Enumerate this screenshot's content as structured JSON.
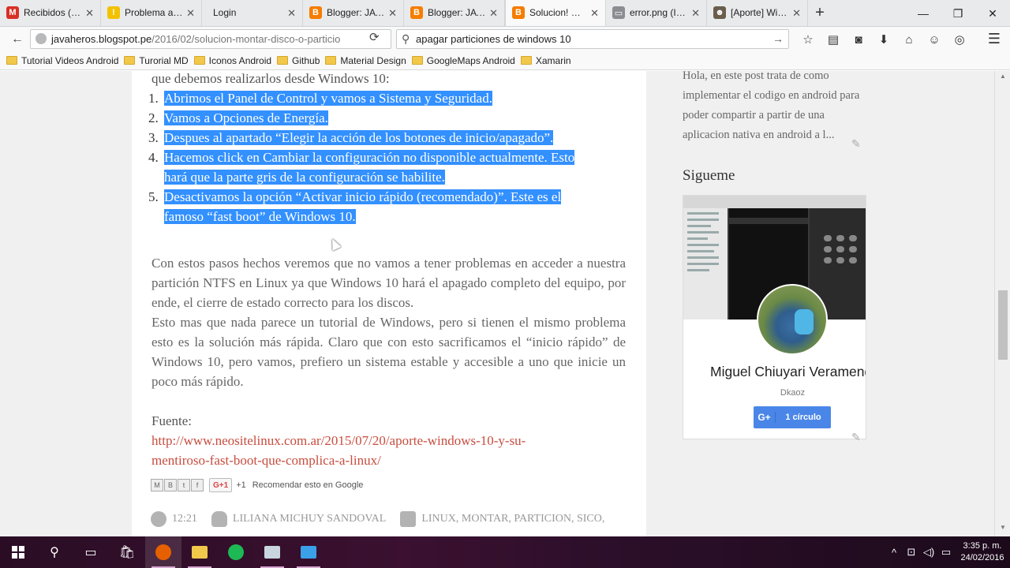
{
  "tabs": [
    {
      "label": "Recibidos (13...",
      "icon": "gmail-icon",
      "color": "#d93025",
      "glyph": "M"
    },
    {
      "label": "Problema al ...",
      "icon": "warning-icon",
      "color": "#f2c200",
      "glyph": "!"
    },
    {
      "label": "Login",
      "icon": "",
      "color": "",
      "glyph": ""
    },
    {
      "label": "Blogger: JAV...",
      "icon": "blogger-icon",
      "color": "#f57d00",
      "glyph": "B"
    },
    {
      "label": "Blogger: JAV...",
      "icon": "blogger-icon",
      "color": "#f57d00",
      "glyph": "B"
    },
    {
      "label": "Solucion! mo...",
      "icon": "blogger-icon",
      "color": "#f57d00",
      "glyph": "B"
    },
    {
      "label": "error.png (Im...",
      "icon": "image-icon",
      "color": "#8a8d91",
      "glyph": "▭"
    },
    {
      "label": "[Aporte] Win...",
      "icon": "penguin-icon",
      "color": "#6a5d4d",
      "glyph": "☻"
    }
  ],
  "active_tab": 5,
  "nav": {
    "url_host": "javaheros.blogspot.pe",
    "url_path": "/2016/02/solucion-montar-disco-o-particio",
    "search_query": "apagar particiones de windows 10"
  },
  "bookmarks": [
    "Tutorial Videos Android",
    "Turorial MD",
    "Iconos Android",
    "Github",
    "Material Design",
    "GoogleMaps Android",
    "Xamarin"
  ],
  "post": {
    "intro": "que debemos realizarlos desde Windows 10:",
    "steps": [
      {
        "num": "1.",
        "lines": [
          "Abrimos el Panel de Control y vamos a Sistema y Seguridad."
        ]
      },
      {
        "num": "2.",
        "lines": [
          "Vamos a Opciones de Energía."
        ]
      },
      {
        "num": "3.",
        "lines": [
          "Despues al apartado “Elegir la acción de los botones de inicio/apagado”."
        ]
      },
      {
        "num": "4.",
        "lines": [
          "Hacemos click en Cambiar la configuración no disponible actualmente. Esto",
          "hará que la parte gris de la configuración se habilite."
        ]
      },
      {
        "num": "5.",
        "lines": [
          "Desactivamos la opción “Activar inicio rápido (recomendado)”. Este es el",
          "famoso “fast boot” de Windows 10."
        ]
      }
    ],
    "para1": "Con estos pasos hechos veremos que no vamos a tener problemas en acceder a nuestra partición NTFS en Linux ya que Windows 10 hará el apagado completo del equipo, por ende, el cierre de estado correcto para los discos.",
    "para2": "Esto mas que nada parece un tutorial de Windows, pero si tienen el mismo problema esto es la solución más rápida. Claro que con esto sacrificamos el “inicio rápido” de Windows 10, pero vamos, prefiero un sistema estable y accesible a uno que inicie un poco más rápido.",
    "source_label": "Fuente:",
    "source_link_line1": "http://www.neositelinux.com.ar/2015/07/20/aporte-windows-10-y-su-",
    "source_link_line2": "mentiroso-fast-boot-que-complica-a-linux/",
    "share": {
      "gplus": "G+1",
      "plus_count": "+1",
      "recommend": "Recomendar esto en Google"
    },
    "meta": {
      "time": "12:21",
      "author": "LILIANA MICHUY SANDOVAL",
      "tags": "LINUX, MONTAR, PARTICION, SICO,"
    }
  },
  "sidebar": {
    "snippet": "Hola, en este post trata de como implementar el codigo en android para poder compartir a partir de una aplicacion nativa en android a l...",
    "follow_title": "Sigueme",
    "profile_name": "Miguel Chiuyari Veramend",
    "profile_handle": "Dkaoz",
    "circle_button": "1 círculo",
    "gplus_glyph": "G+"
  },
  "taskbar": {
    "time": "3:35 p. m.",
    "date": "24/02/2016"
  }
}
